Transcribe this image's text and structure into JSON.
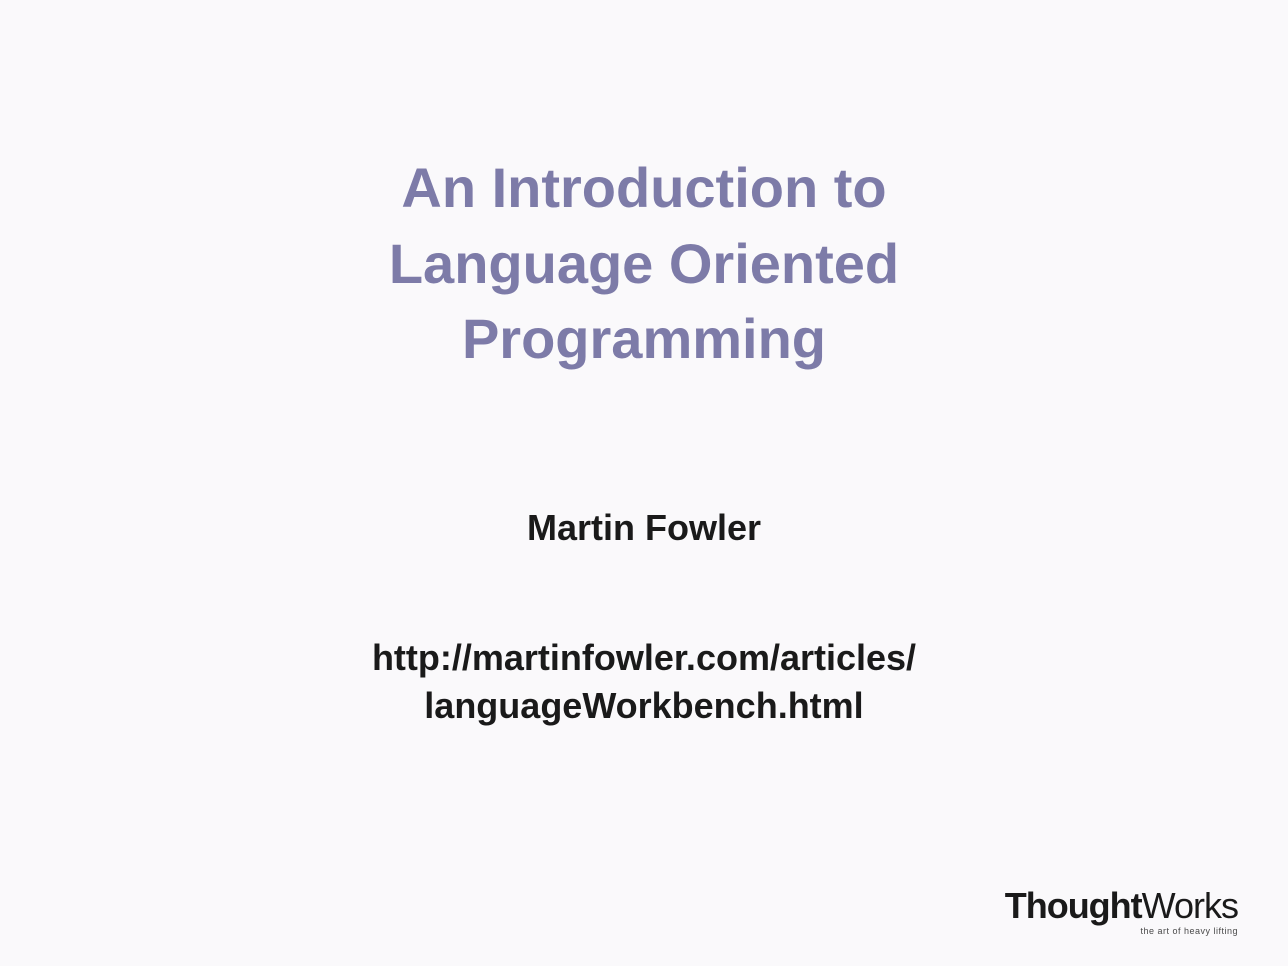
{
  "slide": {
    "title_line1": "An Introduction to",
    "title_line2": "Language Oriented",
    "title_line3": "Programming",
    "author": "Martin Fowler",
    "url_line1": "http://martinfowler.com/articles/",
    "url_line2": "languageWorkbench.html"
  },
  "logo": {
    "brand_bold": "Thought",
    "brand_light": "Works",
    "tagline": "the art of heavy lifting"
  }
}
